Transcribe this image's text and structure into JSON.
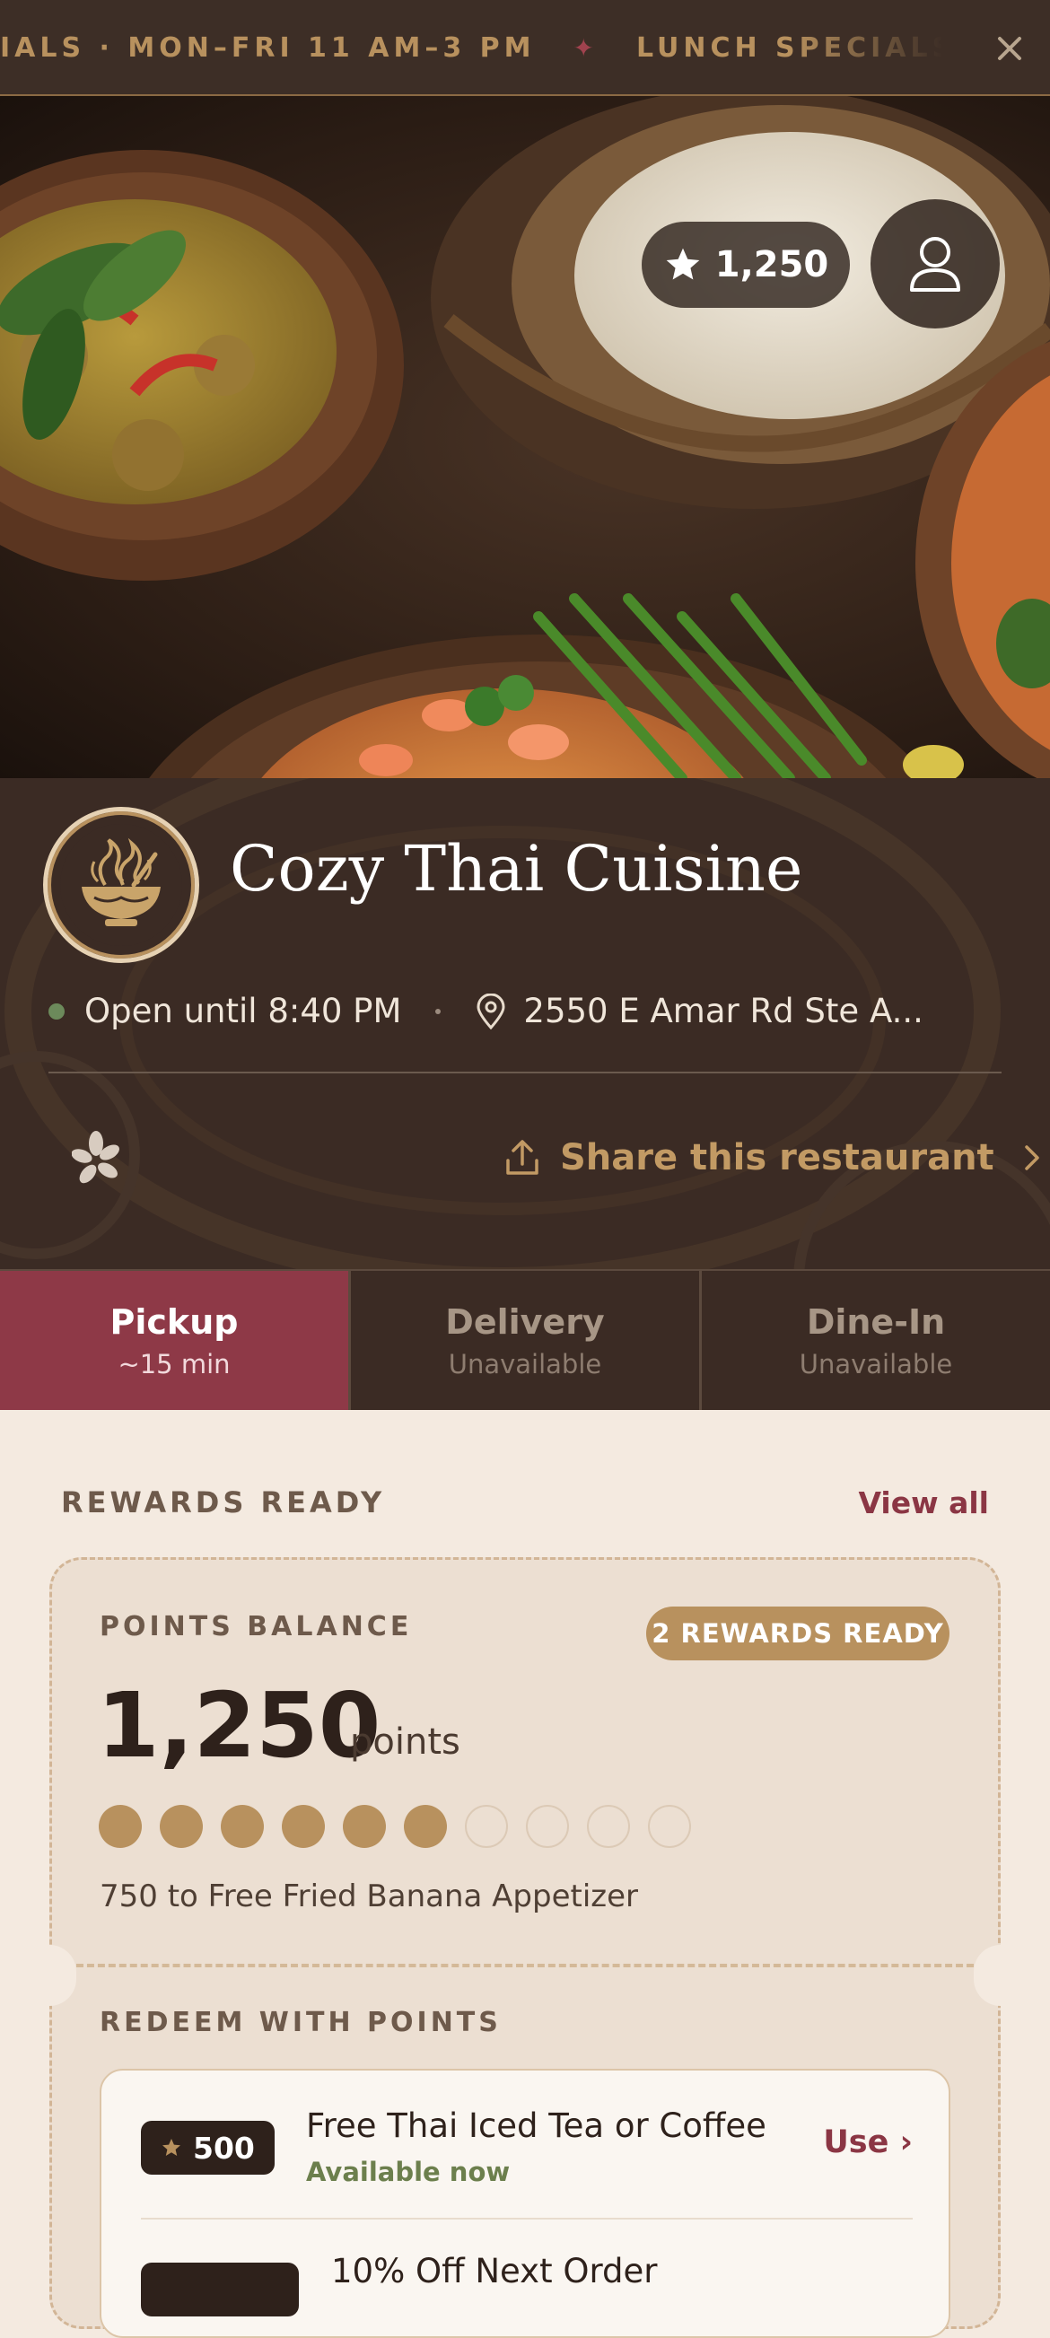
{
  "ticker": {
    "text_left": "IALS · MON–FRI 11 AM–3 PM",
    "separator": "✦",
    "text_right": "LUNCH SPECIALS",
    "close_icon": "close-icon"
  },
  "hero": {
    "points": "1,250",
    "points_icon": "star-icon",
    "account_icon": "user-icon"
  },
  "restaurant": {
    "name": "Cozy Thai Cuisine",
    "status": "Open until 8:40 PM",
    "address": "2550 E Amar Rd Ste A...",
    "share_label": "Share this restaurant"
  },
  "order_modes": [
    {
      "title": "Pickup",
      "subtitle": "~15 min"
    },
    {
      "title": "Delivery",
      "subtitle": "Unavailable"
    },
    {
      "title": "Dine-In",
      "subtitle": "Unavailable"
    }
  ],
  "rewards": {
    "section_title": "REWARDS READY",
    "view_all": "View all",
    "balance_label": "POINTS BALANCE",
    "ready_badge": "2 REWARDS READY",
    "balance": "1,250",
    "balance_unit": "points",
    "progress": {
      "filled": 6,
      "total": 10
    },
    "progress_text": "750 to Free Fried Banana Appetizer",
    "redeem_title": "REDEEM WITH POINTS",
    "items": [
      {
        "cost": "500",
        "name": "Free Thai Iced Tea or Coffee",
        "status": "Available now",
        "action": "Use ›"
      },
      {
        "name": "10% Off Next Order"
      }
    ]
  },
  "colors": {
    "accent": "#8e3947",
    "gold": "#b8915e",
    "dark": "#3b2b24",
    "cream": "#f4eae0"
  }
}
